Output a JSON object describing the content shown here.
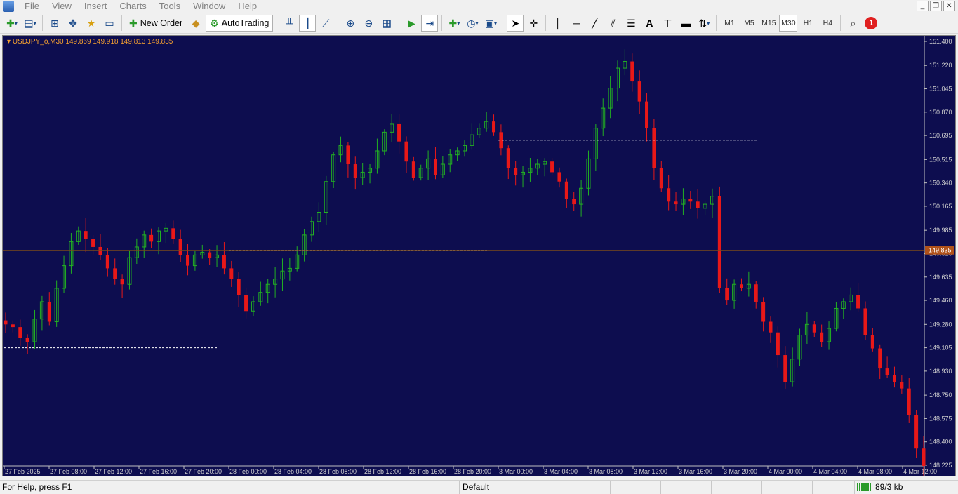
{
  "menu": [
    "File",
    "View",
    "Insert",
    "Charts",
    "Tools",
    "Window",
    "Help"
  ],
  "window_controls": [
    "_",
    "❐",
    "✕"
  ],
  "toolbar": {
    "new_order": "New Order",
    "autotrading": "AutoTrading",
    "timeframes": [
      "M1",
      "M5",
      "M15",
      "M30",
      "H1",
      "H4"
    ],
    "active_timeframe": "M30",
    "notification_count": "1"
  },
  "chart": {
    "title": "USDJPY_o,M30  149.869 149.918 149.813 149.835",
    "background": "#0d0d4f",
    "bull_color": "#22b022",
    "bear_color": "#e81818",
    "current_price_label": "149.835",
    "price_ticks": [
      "151.400",
      "151.220",
      "151.045",
      "150.870",
      "150.695",
      "150.515",
      "150.340",
      "150.165",
      "149.985",
      "149.810",
      "149.635",
      "149.460",
      "149.280",
      "149.105",
      "148.930",
      "148.750",
      "148.575",
      "148.400",
      "148.225"
    ],
    "time_ticks": [
      "27 Feb 2025",
      "27 Feb 08:00",
      "27 Feb 12:00",
      "27 Feb 16:00",
      "27 Feb 20:00",
      "28 Feb 00:00",
      "28 Feb 04:00",
      "28 Feb 08:00",
      "28 Feb 12:00",
      "28 Feb 16:00",
      "28 Feb 20:00",
      "3 Mar 00:00",
      "3 Mar 04:00",
      "3 Mar 08:00",
      "3 Mar 12:00",
      "3 Mar 16:00",
      "3 Mar 20:00",
      "4 Mar 00:00",
      "4 Mar 04:00",
      "4 Mar 08:00",
      "4 Mar 12:00"
    ]
  },
  "status": {
    "help": "For Help, press F1",
    "profile": "Default",
    "traffic": "89/3 kb"
  },
  "chart_data": {
    "type": "candlestick",
    "symbol": "USDJPY_o",
    "timeframe": "M30",
    "ylim": [
      148.225,
      151.4
    ],
    "current_price": 149.835,
    "close_path": [
      149.28,
      149.26,
      149.18,
      149.15,
      149.32,
      149.45,
      149.3,
      149.55,
      149.72,
      149.9,
      149.98,
      149.92,
      149.86,
      149.8,
      149.7,
      149.62,
      149.58,
      149.78,
      149.86,
      149.95,
      149.9,
      149.98,
      150.0,
      149.92,
      149.8,
      149.72,
      149.8,
      149.82,
      149.78,
      149.8,
      149.7,
      149.62,
      149.5,
      149.38,
      149.45,
      149.52,
      149.58,
      149.62,
      149.68,
      149.7,
      149.8,
      149.95,
      150.05,
      150.12,
      150.35,
      150.55,
      150.62,
      150.48,
      150.38,
      150.42,
      150.45,
      150.58,
      150.72,
      150.78,
      150.65,
      150.5,
      150.38,
      150.45,
      150.52,
      150.4,
      150.48,
      150.55,
      150.58,
      150.62,
      150.7,
      150.75,
      150.8,
      150.72,
      150.6,
      150.45,
      150.4,
      150.42,
      150.45,
      150.48,
      150.5,
      150.42,
      150.35,
      150.22,
      150.18,
      150.3,
      150.52,
      150.75,
      150.9,
      151.05,
      151.2,
      151.25,
      151.1,
      150.95,
      150.75,
      150.45,
      150.3,
      150.2,
      150.18,
      150.22,
      150.2,
      150.15,
      150.18,
      150.24,
      149.55,
      149.46,
      149.58,
      149.55,
      149.58,
      149.45,
      149.3,
      149.22,
      149.05,
      148.85,
      149.02,
      149.2,
      149.28,
      149.22,
      149.15,
      149.25,
      149.4,
      149.45,
      149.5,
      149.4,
      149.2,
      149.1,
      148.95,
      148.9,
      148.85,
      148.8,
      148.6,
      148.35,
      148.22
    ],
    "levels": [
      {
        "price": 149.105,
        "from_session": "27 Feb 2025",
        "to_session": "27 Feb 20:00"
      },
      {
        "price": 149.835,
        "from_session": "28 Feb 00:00",
        "to_session": "28 Feb 20:00"
      },
      {
        "price": 150.66,
        "from_session": "3 Mar 00:00",
        "to_session": "3 Mar 20:00"
      },
      {
        "price": 149.5,
        "from_session": "4 Mar 00:00",
        "to_session": "4 Mar 12:00"
      }
    ]
  }
}
